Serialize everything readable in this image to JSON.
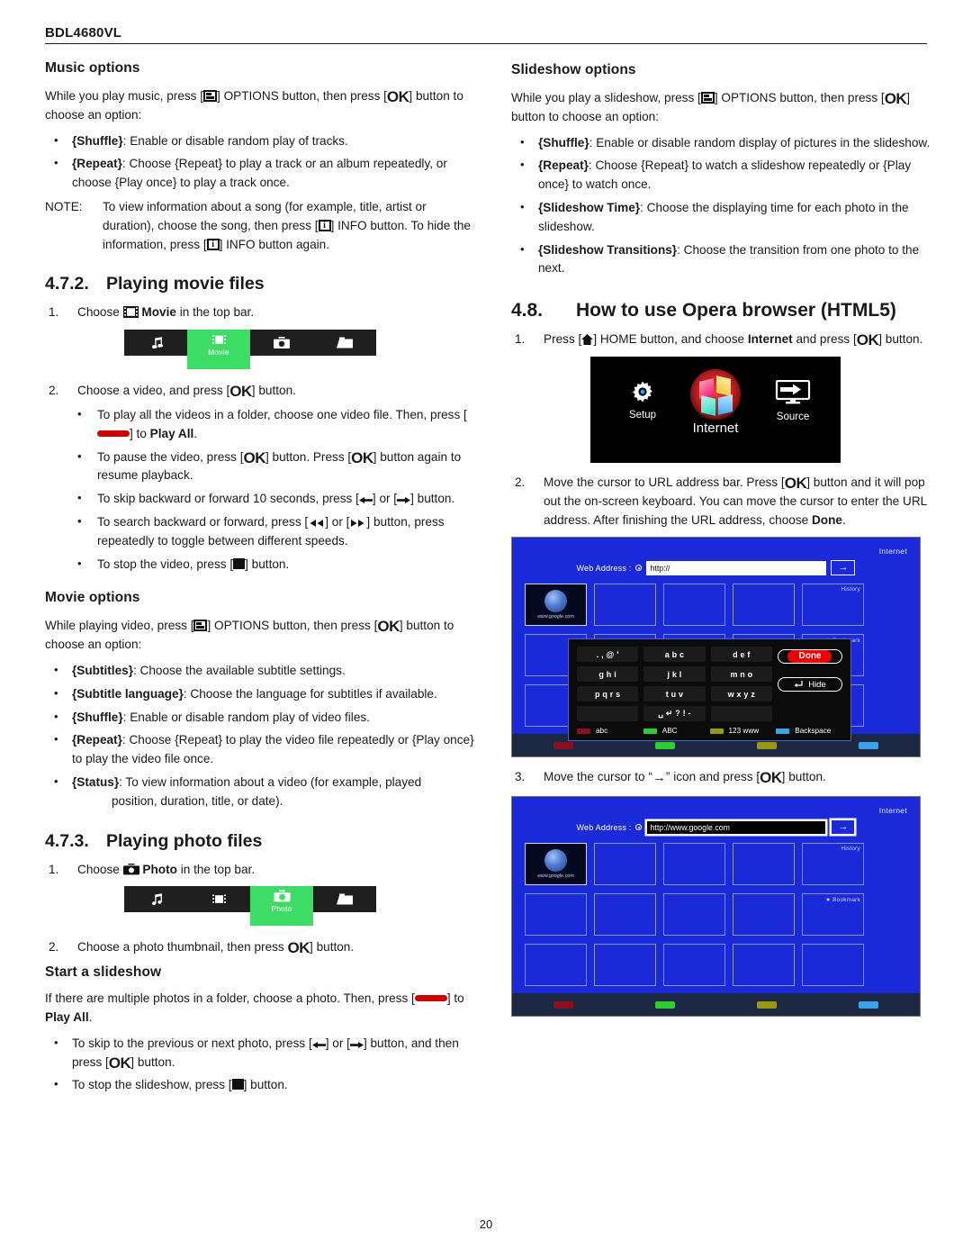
{
  "header": {
    "model": "BDL4680VL"
  },
  "footer": {
    "page_number": "20"
  },
  "left": {
    "music_options": {
      "heading": "Music options",
      "intro_a": "While you play music, press [",
      "intro_b": "] OPTIONS button, then press [",
      "intro_c": "] button to choose an option:",
      "bullets": [
        {
          "term": "{Shuffle}",
          "rest": ": Enable or disable random play of tracks."
        },
        {
          "term": "{Repeat}",
          "rest": ": Choose {Repeat} to play a track or an album repeatedly, or choose {Play once} to play a track once."
        }
      ],
      "note_label": "NOTE:",
      "note_text_a": "To view information about a song (for example, title, artist or duration), choose the song, then press [",
      "note_text_b": "] INFO button. To hide the information, press [",
      "note_text_c": "] INFO button again."
    },
    "movie_section": {
      "number": "4.7.2.",
      "title": "Playing movie files",
      "step1_a": "Choose",
      "step1_b": "Movie",
      "step1_c": "in the top bar.",
      "topbar": {
        "items": [
          {
            "icon": "music-note-icon",
            "label": "",
            "active": false
          },
          {
            "icon": "film-strip-icon",
            "label": "Movie",
            "active": true
          },
          {
            "icon": "camera-icon",
            "label": "",
            "active": false
          },
          {
            "icon": "folder-icon",
            "label": "",
            "active": false
          }
        ]
      },
      "step2_a": "Choose a video, and press [",
      "step2_b": "] button.",
      "bullets": [
        {
          "a": "To play all the videos in a folder, choose one video file. Then, press [",
          "key": "red-bar-key",
          "b": "] to ",
          "bold": "Play All",
          "c": "."
        },
        {
          "a": "To pause the video, press [",
          "key": "ok-key",
          "b": "] button. Press [",
          "key2": "ok-key",
          "c": "] button again to resume playback."
        },
        {
          "a": "To skip backward or forward 10 seconds, press [",
          "key": "skip-back-icon",
          "b": "] or [",
          "key2": "skip-forward-icon",
          "c": "] button."
        },
        {
          "a": "To search backward or forward, press [",
          "key": "rewind-icon",
          "b": "] or [",
          "key2": "fast-forward-icon",
          "c": "] button, press repeatedly to toggle between different speeds."
        },
        {
          "a": "To stop the video, press [",
          "key": "stop-icon",
          "b": "] button."
        }
      ]
    },
    "movie_options": {
      "heading": "Movie options",
      "intro_a": "While playing video, press [",
      "intro_b": "] OPTIONS button, then press [",
      "intro_c": "] button to choose an option:",
      "bullets": [
        {
          "term": "{Subtitles}",
          "rest": ": Choose the available subtitle settings."
        },
        {
          "term": "{Subtitle language}",
          "rest": ": Choose the language for subtitles if available."
        },
        {
          "term": "{Shuffle}",
          "rest": ": Enable or disable random play of video files."
        },
        {
          "term": "{Repeat}",
          "rest": ": Choose {Repeat} to play the video file repeatedly or {Play once} to play the video file once."
        },
        {
          "term": "{Status}",
          "rest": ": To view information about a video (for example, played",
          "hang": "position, duration, title, or date)."
        }
      ]
    },
    "photo_section": {
      "number": "4.7.3.",
      "title": "Playing photo files",
      "step1_a": "Choose",
      "step1_b": "Photo",
      "step1_c": "in the top bar.",
      "topbar": {
        "items": [
          {
            "icon": "music-note-icon",
            "label": "",
            "active": false
          },
          {
            "icon": "film-strip-icon",
            "label": "",
            "active": false
          },
          {
            "icon": "camera-icon",
            "label": "Photo",
            "active": true
          },
          {
            "icon": "folder-icon",
            "label": "",
            "active": false
          }
        ]
      },
      "step2_a": "Choose a photo thumbnail, then press ",
      "step2_b": "] button.",
      "slideshow_heading": "Start a slideshow",
      "slideshow_intro_a": "If there are multiple photos in a folder, choose a photo. Then, press [",
      "slideshow_intro_b": "] to ",
      "slideshow_intro_bold": "Play All",
      "slideshow_intro_c": ".",
      "bullets": [
        {
          "a": "To skip to the previous or next photo, press [",
          "b": "] or [",
          "c": "] button, and then press [",
          "d": "] button."
        },
        {
          "a": "To stop the slideshow, press [",
          "b": "] button."
        }
      ]
    }
  },
  "right": {
    "slideshow_options": {
      "heading": "Slideshow options",
      "intro_a": "While you play a slideshow, press [",
      "intro_b": "] OPTIONS button, then press [",
      "intro_c": "] button to choose an option:",
      "bullets": [
        {
          "term": "{Shuffle}",
          "rest": ": Enable or disable random display of pictures in the slideshow."
        },
        {
          "term": "{Repeat}",
          "rest": ": Choose {Repeat} to watch a slideshow repeatedly or {Play once} to watch once."
        },
        {
          "term": "{Slideshow Time}",
          "rest": ": Choose the displaying time for each photo in the slideshow."
        },
        {
          "term": "{Slideshow Transitions}",
          "rest": ": Choose the transition from one photo to the next."
        }
      ]
    },
    "opera_section": {
      "number": "4.8.",
      "title": "How to use Opera browser (HTML5)",
      "step1_a": "Press [",
      "step1_b": "] HOME button, and choose ",
      "step1_bold": "Internet",
      "step1_c": " and press [",
      "step1_d": "] button.",
      "home_screen": {
        "setup_label": "Setup",
        "internet_label": "Internet",
        "source_label": "Source"
      },
      "step2": "Move the cursor to URL address bar. Press [",
      "step2_b": "] button and it will pop out the on-screen keyboard. You can move the cursor to enter the URL address. After finishing the URL address, choose ",
      "step2_bold": "Done",
      "step2_c": ".",
      "step3_a": "Move the cursor to “",
      "step3_arrow": "→",
      "step3_b": "” icon and press [",
      "step3_c": "] button."
    },
    "browser_shot_1": {
      "title": "Internet",
      "address_label": "Web Address :",
      "address_value": "http://",
      "go_label": "→",
      "tile_google_label": "www.google.com",
      "history_label": "History",
      "bookmark_label": "★ Bookmark",
      "keyboard": {
        "rows": [
          [
            ". , @ '",
            "a  b  c",
            "d  e  f"
          ],
          [
            "g  h  i",
            "j  k  l",
            "m  n  o"
          ],
          [
            "p q r s",
            "t  u  v",
            "w x y z"
          ],
          [
            "",
            "␣ ↵ ? ! -",
            ""
          ]
        ],
        "done_label": "Done",
        "hide_label": "Hide",
        "legend": [
          {
            "color": "#8a0f22",
            "label": "abc"
          },
          {
            "color": "#2ccf2c",
            "label": "ABC"
          },
          {
            "color": "#9a9a10",
            "label": "123 www"
          },
          {
            "color": "#3ba2e8",
            "label": "Backspace"
          }
        ]
      },
      "foot_colors": [
        "#8a0f22",
        "#2ccf2c",
        "#9a9a10",
        "#3ba2e8"
      ]
    },
    "browser_shot_2": {
      "title": "Internet",
      "address_label": "Web Address :",
      "address_value": "http://www.google.com",
      "go_label": "→",
      "tile_google_label": "www.google.com",
      "history_label": "History",
      "bookmark_label": "★ Bookmark",
      "foot_colors": [
        "#8a0f22",
        "#2ccf2c",
        "#9a9a10",
        "#3ba2e8"
      ]
    }
  }
}
